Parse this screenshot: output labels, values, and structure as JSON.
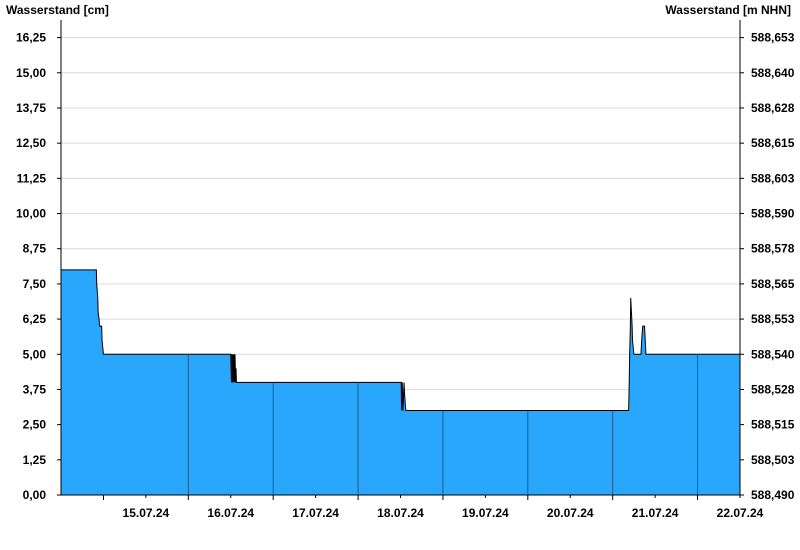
{
  "chart_data": {
    "type": "area",
    "title": "",
    "ylabel_left": "Wasserstand [cm]",
    "ylabel_right": "Wasserstand [m NHN]",
    "x_unit": "hours since first day boundary",
    "x_range_hours": [
      -12,
      180
    ],
    "ylim": [
      0,
      16.875
    ],
    "y_ticks": [
      "0,00",
      "1,25",
      "2,50",
      "3,75",
      "5,00",
      "6,25",
      "7,50",
      "8,75",
      "10,00",
      "11,25",
      "12,50",
      "13,75",
      "15,00",
      "16,25"
    ],
    "y_ticks_right": [
      "588,490",
      "588,503",
      "588,515",
      "588,528",
      "588,540",
      "588,553",
      "588,565",
      "588,578",
      "588,590",
      "588,603",
      "588,615",
      "588,628",
      "588,640",
      "588,653"
    ],
    "x_ticks": [
      "15.07.24",
      "16.07.24",
      "17.07.24",
      "18.07.24",
      "19.07.24",
      "20.07.24",
      "21.07.24",
      "22.07.24"
    ],
    "grid": true,
    "fill_color": "#29a7fd",
    "line_color": "#000000",
    "series": [
      {
        "x": [
          -12,
          -2,
          -1.9,
          -1.6,
          -1.5,
          -1.2,
          -1.1,
          -0.5,
          -0.4,
          0,
          24,
          36,
          36.2,
          36.3,
          36.5,
          36.6,
          36.8,
          36.9,
          37.1,
          37.2,
          37.4,
          37.5,
          37.6,
          38,
          38.3,
          48,
          72,
          84.2,
          84.3,
          84.5,
          84.7,
          85,
          85.2,
          85.5,
          85.6,
          96,
          120,
          144,
          148.5,
          148.6,
          148.8,
          149,
          149.1,
          149.3,
          149.5,
          149.6,
          150,
          150.5,
          151,
          152,
          152.2,
          152.5,
          152.7,
          153,
          153.2,
          153.4,
          153.7,
          154,
          168,
          180
        ],
        "y": [
          8.0,
          8.0,
          7.5,
          7.0,
          6.5,
          6.2,
          6.0,
          6.0,
          5.5,
          5.0,
          5.0,
          5.0,
          4.0,
          5.0,
          4.0,
          5.0,
          4.0,
          5.0,
          4.0,
          5.0,
          4.0,
          4.5,
          4.0,
          4.0,
          4.0,
          4.0,
          4.0,
          4.0,
          3.0,
          4.0,
          3.0,
          4.0,
          3.5,
          3.0,
          3.0,
          3.0,
          3.0,
          3.0,
          3.0,
          3.5,
          5.0,
          6.0,
          7.0,
          6.5,
          6.0,
          5.5,
          5.0,
          5.0,
          5.0,
          5.0,
          5.5,
          6.0,
          6.0,
          6.0,
          5.5,
          5.0,
          5.0,
          5.0,
          5.0,
          5.0
        ]
      }
    ]
  }
}
